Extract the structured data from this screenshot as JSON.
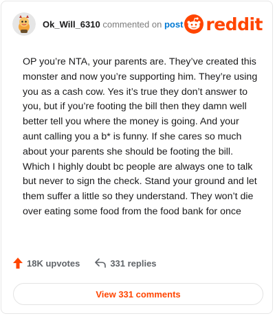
{
  "header": {
    "username": "Ok_Will_6310",
    "action": "commented on",
    "post_link": "post",
    "brand": "reddit",
    "brand_color": "#ff4500"
  },
  "comment": {
    "text": "OP you’re NTA, your parents are. They’ve created this monster and now you’re supporting him. They’re using you as a cash cow. Yes it’s true they don’t answer to you, but if you’re footing the bill then they damn well better tell you where the money is going. And your aunt calling you a b* is funny. If she cares so much about your parents she should be footing the bill. Which I highly doubt bc people are always one to talk but never to sign the check. Stand your ground and let them suffer a little so they understand. They won’t die over eating some food from the food bank for once"
  },
  "footer": {
    "upvotes": "18K upvotes",
    "replies": "331 replies",
    "view_button": "View 331 comments"
  },
  "icons": {
    "avatar": "snoo-avatar-icon",
    "logo": "reddit-logo-icon",
    "upvote": "upvote-arrow-icon",
    "reply": "reply-arrow-icon"
  }
}
